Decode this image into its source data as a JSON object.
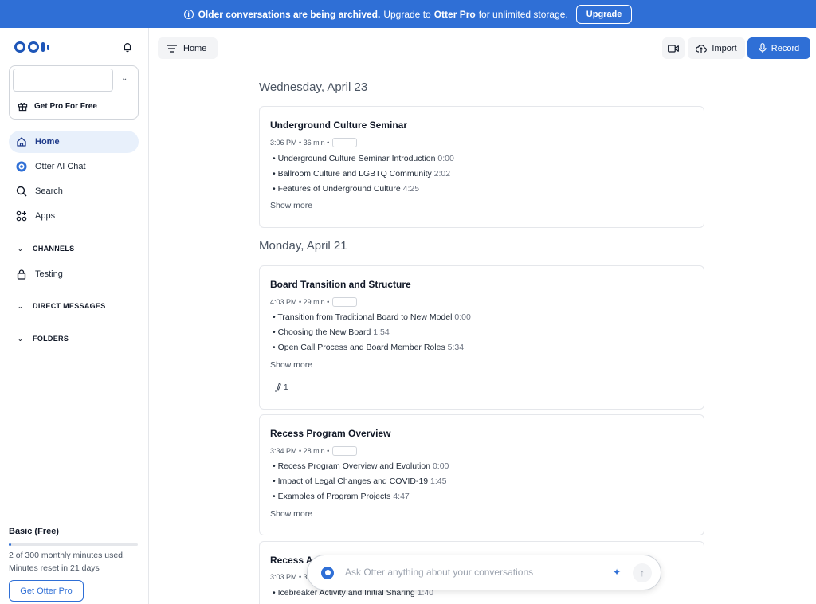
{
  "banner": {
    "bold_text": "Older conversations are being archived.",
    "text_before_pro": "Upgrade to",
    "pro_name": "Otter Pro",
    "text_after_pro": "for unlimited storage.",
    "button_label": "Upgrade"
  },
  "sidebar": {
    "workspace_value": "",
    "get_pro_label": "Get Pro For Free",
    "nav": [
      {
        "label": "Home",
        "icon": "home-icon",
        "active": true
      },
      {
        "label": "Otter AI Chat",
        "icon": "otter-icon",
        "active": false
      },
      {
        "label": "Search",
        "icon": "search-icon",
        "active": false
      },
      {
        "label": "Apps",
        "icon": "apps-icon",
        "active": false
      }
    ],
    "channels_header": "CHANNELS",
    "channels": [
      {
        "label": "Testing",
        "icon": "lock-icon"
      }
    ],
    "dm_header": "DIRECT MESSAGES",
    "folders_header": "FOLDERS",
    "plan": {
      "title": "Basic (Free)",
      "usage": "2 of 300 monthly minutes used.",
      "usage_fraction": 0.0067,
      "reset": "Minutes reset in 21 days",
      "button_label": "Get Otter Pro"
    }
  },
  "topbar": {
    "home_label": "Home",
    "import_label": "Import",
    "record_label": "Record"
  },
  "conversations": {
    "day1": "Wednesday, April 23",
    "day2": "Monday, April 21",
    "cards": [
      {
        "title": "Underground Culture Seminar",
        "meta": "3:06 PM • 36 min •",
        "bullets": [
          {
            "text": "Underground Culture Seminar Introduction",
            "ts": "0:00"
          },
          {
            "text": "Ballroom Culture and LGBTQ Community",
            "ts": "2:02"
          },
          {
            "text": "Features of Underground Culture",
            "ts": "4:25"
          }
        ],
        "show_more": "Show more"
      },
      {
        "title": "Board Transition and Structure",
        "meta": "4:03 PM • 29 min •",
        "bullets": [
          {
            "text": "Transition from Traditional Board to New Model",
            "ts": "0:00"
          },
          {
            "text": "Choosing the New Board",
            "ts": "1:54"
          },
          {
            "text": "Open Call Process and Board Member Roles",
            "ts": "5:34"
          }
        ],
        "show_more": "Show more",
        "mention_count": "1"
      },
      {
        "title": "Recess Program Overview",
        "meta": "3:34 PM • 28 min •",
        "bullets": [
          {
            "text": "Recess Program Overview and Evolution",
            "ts": "0:00"
          },
          {
            "text": "Impact of Legal Changes and COVID-19",
            "ts": "1:45"
          },
          {
            "text": "Examples of Program Projects",
            "ts": "4:47"
          }
        ],
        "show_more": "Show more"
      },
      {
        "title": "Recess A",
        "meta": "3:03 PM • 3",
        "bullets": [
          {
            "text": "Icebreaker Activity and Initial Sharing",
            "ts": "1:40"
          }
        ]
      }
    ]
  },
  "ask": {
    "placeholder": "Ask Otter anything about your conversations"
  },
  "colors": {
    "brand_blue": "#2f6fd6",
    "active_nav_bg": "#e8f0fb"
  }
}
